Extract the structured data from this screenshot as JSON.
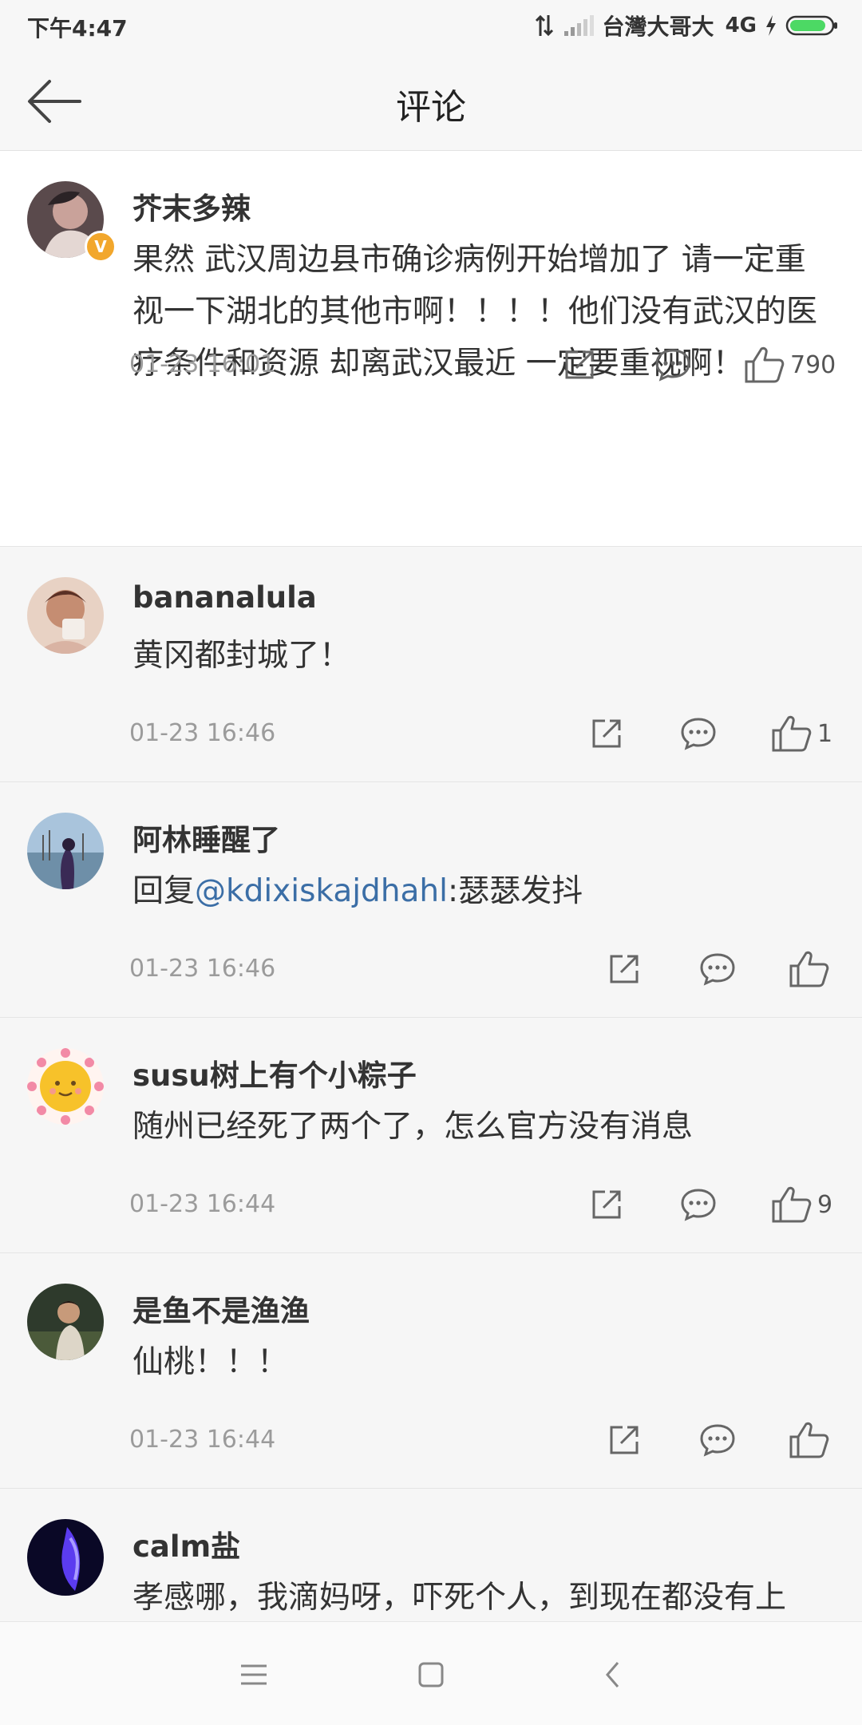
{
  "status_bar": {
    "time": "下午4:47",
    "carrier": "台灣大哥大",
    "network": "4G"
  },
  "header": {
    "title": "评论",
    "back_icon": "arrow-left-icon"
  },
  "comments": [
    {
      "username": "芥末多辣",
      "verified": true,
      "text": "果然 武汉周边县市确诊病例开始增加了 请一定重视一下湖北的其他市啊！！！！他们没有武汉的医疗条件和资源 却离武汉最近 一定要重视啊！",
      "time": "01-23 16:01",
      "likes": "790"
    },
    {
      "username": "bananalula",
      "text": "黄冈都封城了！",
      "time": "01-23 16:46",
      "likes": "1"
    },
    {
      "username": "阿林睡醒了",
      "text_prefix": "回复",
      "mention": "@kdixiskajdhahl",
      "text_suffix": ":瑟瑟发抖",
      "time": "01-23 16:46",
      "likes": ""
    },
    {
      "username": "susu树上有个小粽子",
      "text": "随州已经死了两个了，怎么官方没有消息",
      "time": "01-23 16:44",
      "likes": "9"
    },
    {
      "username": "是鱼不是渔渔",
      "text": "仙桃！！！",
      "time": "01-23 16:44",
      "likes": ""
    },
    {
      "username": "calm盐",
      "text": "孝感哪，我滴妈呀，吓死个人，到现在都没有上"
    }
  ],
  "colors": {
    "mention": "#3b6ea6",
    "verified_badge": "#f2a72c",
    "timestamp": "#9b9b9b"
  },
  "nav_bar": {
    "icons": [
      "menu-icon",
      "home-icon",
      "back-icon"
    ]
  }
}
